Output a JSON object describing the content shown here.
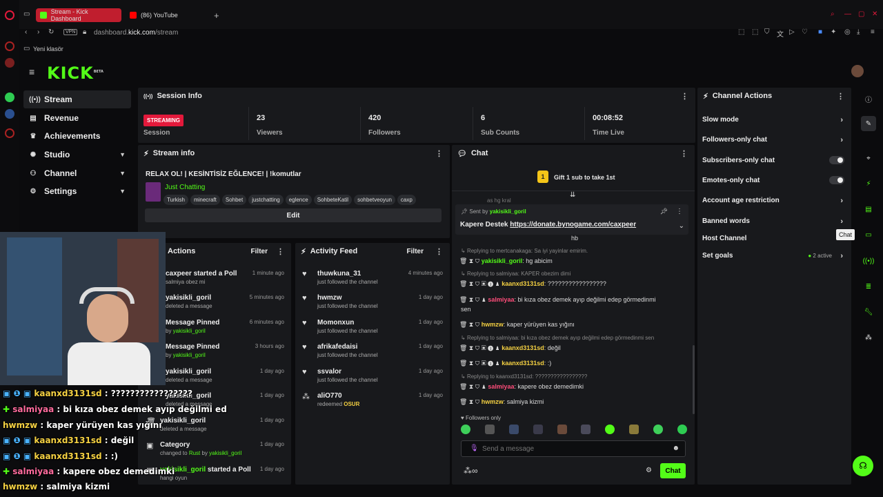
{
  "browser": {
    "tabs": [
      {
        "label": "Stream - Kick Dashboard",
        "fav": "#53fc18"
      },
      {
        "label": "(86) YouTube",
        "fav": "#ff0000"
      }
    ],
    "url_prefix": "dashboard.",
    "url_host": "kick.com",
    "url_path": "/stream",
    "vpn": "VPN",
    "bookmark": "Yeni klasör"
  },
  "brand": {
    "logo": "KICK",
    "beta": "BETA",
    "accent": "#53fc18",
    "live_red": "#e3193b"
  },
  "sidebar": {
    "items": [
      {
        "label": "Stream",
        "icon": "broadcast-icon"
      },
      {
        "label": "Revenue",
        "icon": "wallet-icon"
      },
      {
        "label": "Achievements",
        "icon": "trophy-icon"
      },
      {
        "label": "Studio",
        "icon": "studio-icon"
      },
      {
        "label": "Channel",
        "icon": "channel-icon"
      },
      {
        "label": "Settings",
        "icon": "gear-icon"
      }
    ]
  },
  "session": {
    "title": "Session Info",
    "status": "STREAMING",
    "status_label": "Session",
    "viewers": "23",
    "viewers_label": "Viewers",
    "followers": "420",
    "followers_label": "Followers",
    "subs": "6",
    "subs_label": "Sub Counts",
    "time": "00:08:52",
    "time_label": "Time Live"
  },
  "stream_info": {
    "title": "Stream info",
    "stream_title": "RELAX OL! | KESİNTİSİZ EĞLENCE! | !komutlar",
    "category": "Just Chatting",
    "tags": [
      "Turkish",
      "minecraft",
      "Sohbet",
      "justchatting",
      "eglence",
      "SohbeteKatil",
      "sohbetveoyun",
      "caxp"
    ],
    "edit": "Edit"
  },
  "actions_feed": {
    "title": "Actions",
    "filter": "Filter",
    "items": [
      {
        "title": "caxpeer started a Poll",
        "sub": "salmiya obez mi",
        "time": "1 minute ago"
      },
      {
        "title": "yakisikli_goril",
        "sub": "deleted a message",
        "time": "5 minutes ago"
      },
      {
        "title": "Message Pinned",
        "sub_prefix": "by ",
        "sub_user": "yakisikli_goril",
        "time": "6 minutes ago"
      },
      {
        "title": "Message Pinned",
        "sub_prefix": "by ",
        "sub_user": "yakisikli_goril",
        "time": "3 hours ago"
      },
      {
        "title": "yakisikli_goril",
        "sub": "deleted a message",
        "time": "1 day ago"
      },
      {
        "title": "yakisikli_goril",
        "sub": "deleted a message",
        "time": "1 day ago"
      },
      {
        "title": "yakisikli_goril",
        "sub": "deleted a message",
        "time": "1 day ago"
      },
      {
        "title": "Category",
        "sub_prefix": "changed to ",
        "sub_cat": "Rust",
        "sub_mid": " by ",
        "sub_user": "yakisikli_goril",
        "time": "1 day ago"
      },
      {
        "title_user": "yakisikli_goril",
        "title_rest": " started a Poll",
        "sub": "hangi oyun",
        "time": "1 day ago"
      }
    ]
  },
  "activity_feed": {
    "title": "Activity Feed",
    "filter": "Filter",
    "items": [
      {
        "title": "thuwkuna_31",
        "sub": "just followed the channel",
        "time": "4 minutes ago"
      },
      {
        "title": "hwmzw",
        "sub": "just followed the channel",
        "time": "1 day ago"
      },
      {
        "title": "Momonxun",
        "sub": "just followed the channel",
        "time": "1 day ago"
      },
      {
        "title": "afrikafedaisi",
        "sub": "just followed the channel",
        "time": "1 day ago"
      },
      {
        "title": "ssvalor",
        "sub": "just followed the channel",
        "time": "1 day ago"
      },
      {
        "title": "aliO770",
        "sub_prefix": "redeemed ",
        "sub_reward": "OSUR",
        "time": "1 day ago"
      }
    ]
  },
  "chat": {
    "title": "Chat",
    "gift_count": "1",
    "gift_text": "Gift 1 sub to take 1st",
    "pinned_sent_by": "Sent by",
    "pinned_user": "yakisikli_goril",
    "pinned_text": "Kapere Destek ",
    "pinned_link": "https://donate.bynogame.com/caxpeer",
    "cut_top": "as hg kral",
    "cut_top2": "hb",
    "messages": [
      {
        "reply": "Replying to mertcanakaga: Sa iyi yayinlar emirim.",
        "user": "yakisikli_goril",
        "color": "#53fc18",
        "text": ": hg abicim"
      },
      {
        "reply": "Replying to salmiyaa: KAPER obezim dimi",
        "user": "kaanxd3131sd",
        "color": "#f5d142",
        "text": ": ?????????????????"
      },
      {
        "user": "salmiyaa",
        "color": "#ff4d7a",
        "text": ": bi kıza obez demek ayıp değilmi edep görmedinmi",
        "text2": "sen"
      },
      {
        "user": "hwmzw",
        "color": "#f5d142",
        "text": ": kaper yürüyen kas yığını"
      },
      {
        "reply": "Replying to salmiyaa: bi kıza obez demek ayıp değilmi edep görmedinmi sen",
        "user": "kaanxd3131sd",
        "color": "#f5d142",
        "text": ": değil"
      },
      {
        "user": "kaanxd3131sd",
        "color": "#f5d142",
        "text": ": :)"
      },
      {
        "reply": "Replying to kaanxd3131sd: ?????????????????",
        "user": "salmiyaa",
        "color": "#ff4d7a",
        "text": ": kapere obez demedimki"
      },
      {
        "user": "hwmzw",
        "color": "#f5d142",
        "text": ": salmiya kizmi"
      }
    ],
    "followers_only": "Followers only",
    "placeholder": "Send a message",
    "send": "Chat"
  },
  "channel_actions": {
    "title": "Channel Actions",
    "rows": [
      {
        "label": "Slow mode",
        "kind": "arrow"
      },
      {
        "label": "Followers-only chat",
        "kind": "arrow"
      },
      {
        "label": "Subscribers-only chat",
        "kind": "toggle"
      },
      {
        "label": "Emotes-only chat",
        "kind": "toggle"
      },
      {
        "label": "Account age restriction",
        "kind": "arrow"
      },
      {
        "label": "Banned words",
        "kind": "arrow"
      },
      {
        "label": "Host Channel",
        "kind": "none"
      },
      {
        "label": "Set goals",
        "kind": "arrow",
        "extra": "2 active"
      }
    ],
    "tooltip": "Chat"
  },
  "overlay": {
    "lines": [
      {
        "user": "kaanxd3131sd",
        "ucolor": "yel",
        "text": " : ?????????????????"
      },
      {
        "user": "salmiyaa",
        "ucolor": "pink",
        "text": " : bi kıza obez demek ayıp değilmi ed"
      },
      {
        "user": "hwmzw",
        "ucolor": "yel",
        "text": " : kaper yürüyen kas yığını"
      },
      {
        "user": "kaanxd3131sd",
        "ucolor": "yel",
        "text": " : değil"
      },
      {
        "user": "kaanxd3131sd",
        "ucolor": "yel",
        "text": " : :)"
      },
      {
        "user": "salmiyaa",
        "ucolor": "pink",
        "text": " : kapere obez demedimki"
      },
      {
        "user": "hwmzw",
        "ucolor": "yel",
        "text": " : salmiya kizmi"
      }
    ]
  }
}
